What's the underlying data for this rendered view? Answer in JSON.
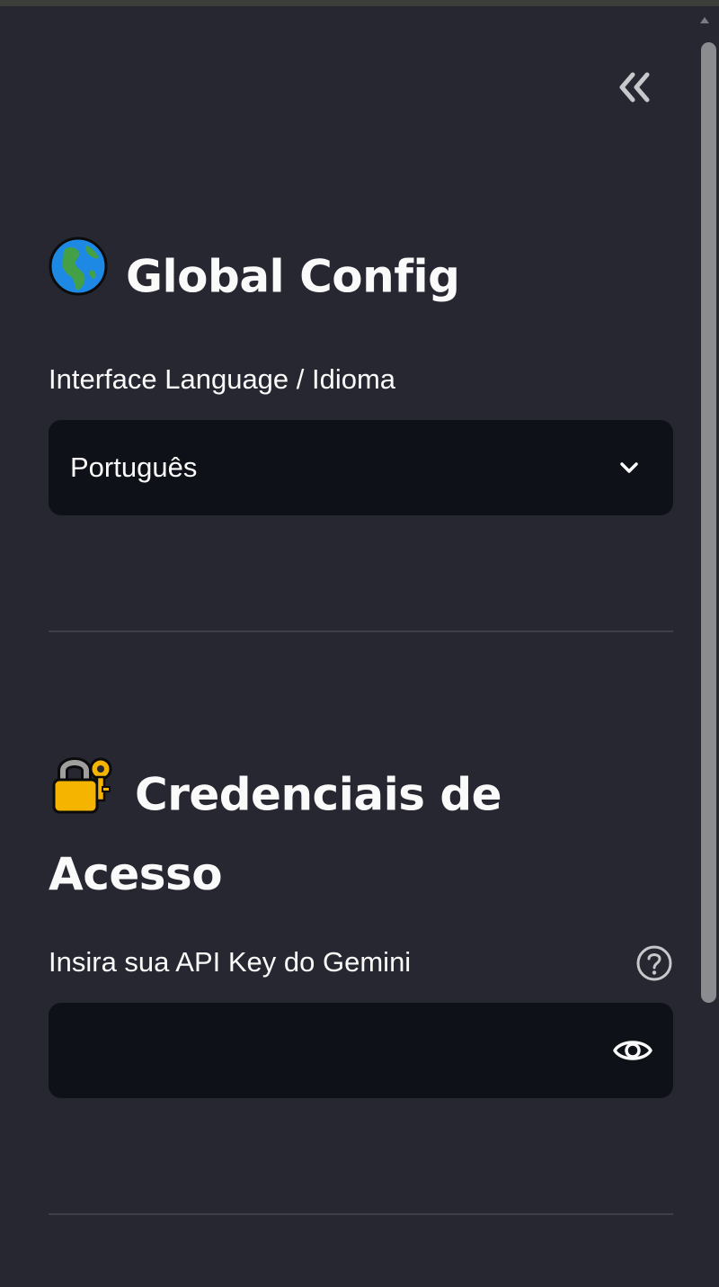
{
  "sidebar": {
    "collapse_icon": "double-chevron-left-icon",
    "global_config": {
      "icon": "globe-icon",
      "title": "Global Config",
      "language_label": "Interface Language / Idioma",
      "language_selected": "Português"
    },
    "credentials": {
      "icon": "locked-with-key-icon",
      "title": "Credenciais de Acesso",
      "api_key_label": "Insira sua API Key do Gemini",
      "api_key_value": "",
      "help_icon": "question-circle-icon",
      "visibility_icon": "eye-icon"
    }
  },
  "colors": {
    "background": "#262730",
    "input_background": "#0e1117",
    "text": "#fafafa",
    "divider": "#3d3f47"
  }
}
